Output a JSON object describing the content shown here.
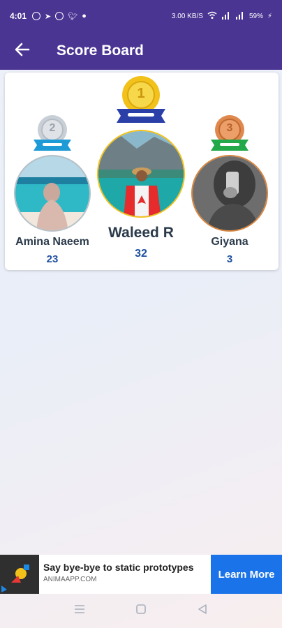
{
  "status_bar": {
    "time": "4:01",
    "left_icons": [
      "whatsapp-icon",
      "telegram-icon",
      "messenger-icon",
      "twitter-icon",
      "dot-icon"
    ],
    "network_speed": "3.00 KB/S",
    "battery": "59%"
  },
  "app_bar": {
    "title": "Score Board"
  },
  "leaderboard": [
    {
      "rank": "2",
      "name": "Amina Naeem",
      "score": "23",
      "medal_color": "#c9cfd6",
      "ribbon_color": "#1e9ad6"
    },
    {
      "rank": "1",
      "name": "Waleed R",
      "score": "32",
      "medal_color": "#f2c21a",
      "ribbon_color": "#2a3fa8"
    },
    {
      "rank": "3",
      "name": "Giyana",
      "score": "3",
      "medal_color": "#e0894e",
      "ribbon_color": "#23a94a"
    }
  ],
  "ad": {
    "headline": "Say bye-bye to static prototypes",
    "domain": "ANIMAAPP.COM",
    "cta": "Learn More"
  },
  "colors": {
    "primary": "#4b3593",
    "score": "#1e4fa0",
    "cta": "#1a73e8"
  }
}
